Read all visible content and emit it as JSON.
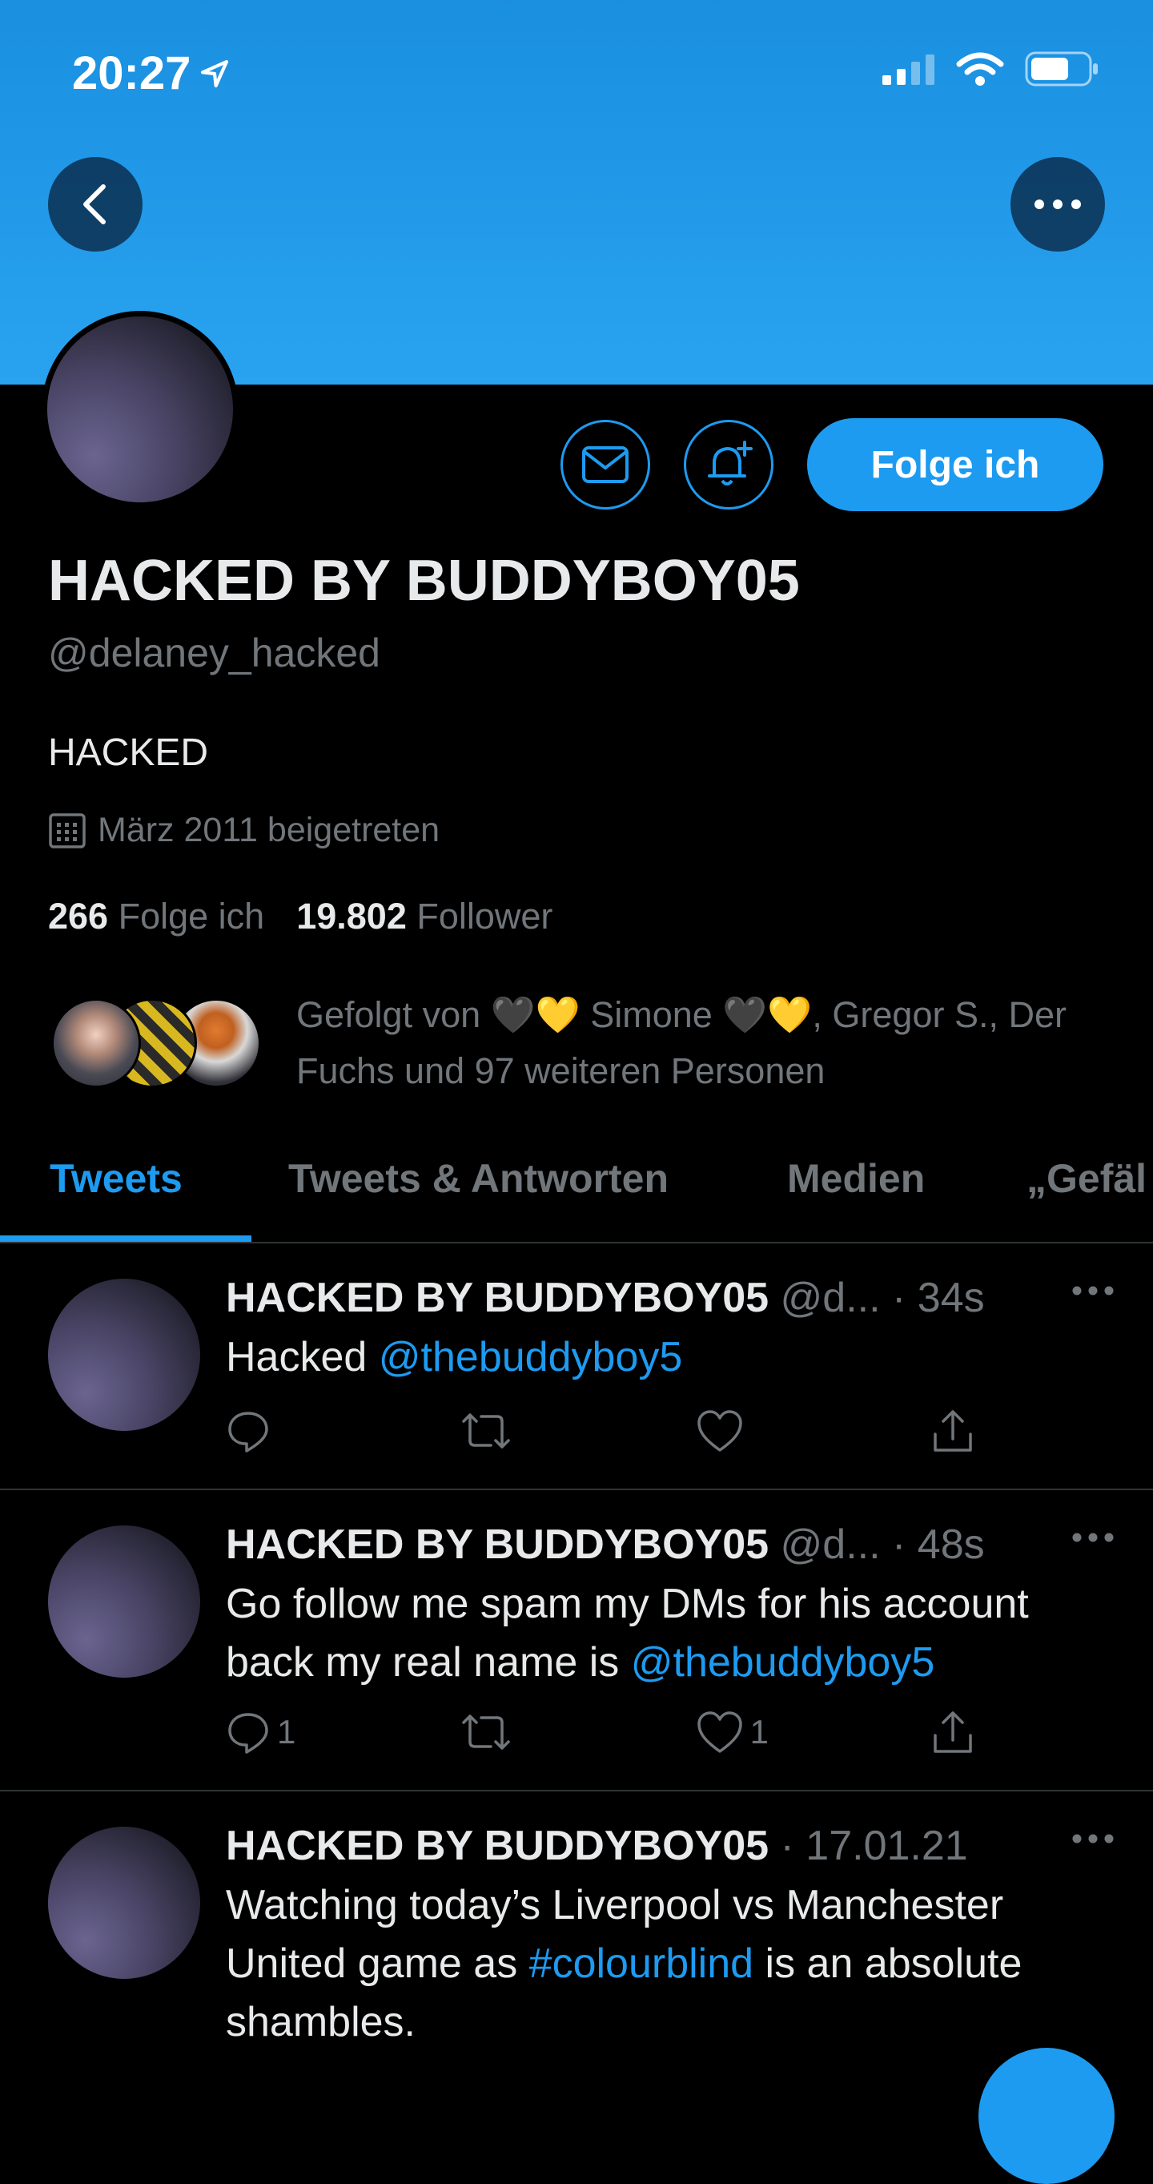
{
  "status_bar": {
    "time": "20:27"
  },
  "profile": {
    "name": "HACKED BY BUDDYBOY05",
    "handle": "@delaney_hacked",
    "bio": "HACKED",
    "joined": "März 2011 beigetreten",
    "following_count": "266",
    "following_label": "Folge ich",
    "followers_count": "19.802",
    "followers_label": "Follower",
    "follow_button_label": "Folge ich",
    "followed_by_prefix": "Gefolgt von",
    "followed_by_name1": "Simone",
    "followed_by_rest": ", Gregor S., Der Fuchs und 97 weiteren Personen",
    "followed_by_emoji": "🖤💛"
  },
  "tabs": [
    {
      "label": "Tweets",
      "active": true
    },
    {
      "label": "Tweets & Antworten",
      "active": false
    },
    {
      "label": "Medien",
      "active": false
    },
    {
      "label": "„Gefäl",
      "active": false
    }
  ],
  "tweets": [
    {
      "name": "HACKED BY BUDDYBOY05",
      "handle": "@d...",
      "time": "· 34s",
      "text_before": "Hacked ",
      "link": "@thebuddyboy5",
      "text_after": "",
      "replies": "",
      "likes": ""
    },
    {
      "name": "HACKED BY BUDDYBOY05",
      "handle": "@d...",
      "time": "· 48s",
      "text_before": "Go follow me spam my DMs for his account back my real name is ",
      "link": "@thebuddyboy5",
      "text_after": "",
      "replies": "1",
      "likes": "1"
    },
    {
      "name": "HACKED BY BUDDYBOY05",
      "handle": "",
      "time": "· 17.01.21",
      "text_before": "Watching today’s Liverpool vs Manchester United game as ",
      "link": "#colourblind",
      "text_after": " is an absolute shambles.",
      "replies": "",
      "likes": ""
    }
  ],
  "colors": {
    "accent": "#1d9bf0",
    "banner": "#29a3f0",
    "background": "#000000",
    "muted": "#71767b"
  }
}
